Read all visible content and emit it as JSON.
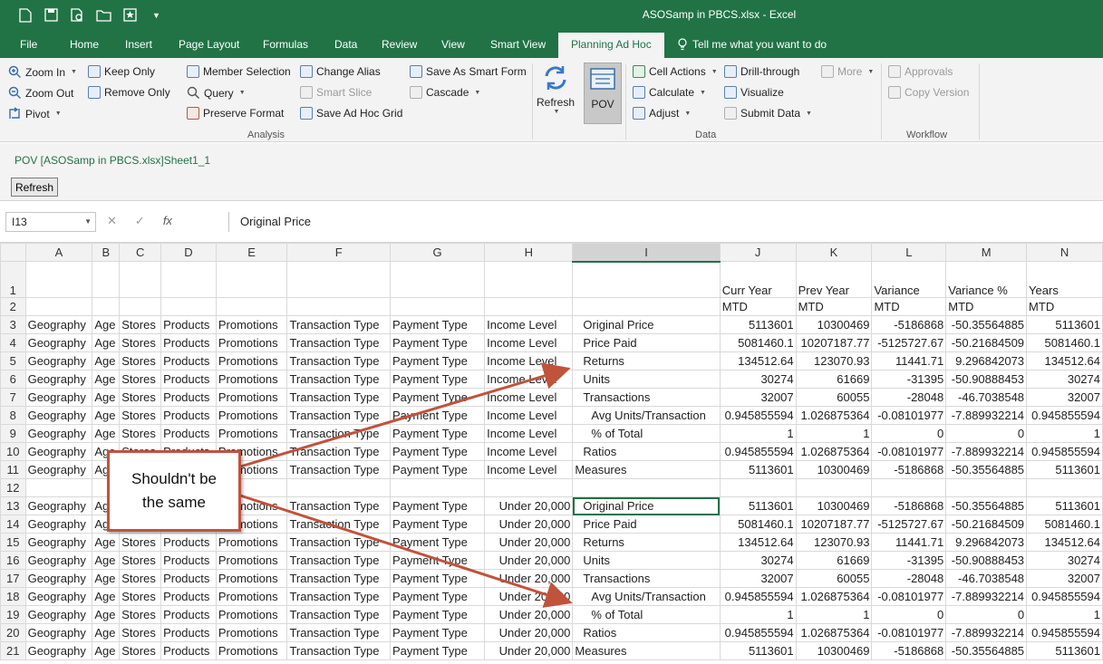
{
  "window": {
    "title": "ASOSamp in PBCS.xlsx  -  Excel"
  },
  "qat_icons": [
    "new-file-icon",
    "save-icon",
    "print-preview-icon",
    "open-folder-icon",
    "smart-view-icon",
    "qat-customize-icon"
  ],
  "tabs": [
    "File",
    "Home",
    "Insert",
    "Page Layout",
    "Formulas",
    "Data",
    "Review",
    "View",
    "Smart View",
    "Planning Ad Hoc"
  ],
  "active_tab": "Planning Ad Hoc",
  "tell_me": "Tell me what you want to do",
  "ribbon": {
    "analysis": {
      "label": "Analysis",
      "zoom_in": "Zoom In",
      "zoom_out": "Zoom Out",
      "pivot": "Pivot",
      "keep_only": "Keep Only",
      "remove_only": "Remove Only",
      "member_selection": "Member Selection",
      "query": "Query",
      "preserve_format": "Preserve Format",
      "change_alias": "Change Alias",
      "smart_slice": "Smart Slice",
      "save_ad_hoc_grid": "Save Ad Hoc Grid",
      "save_as_smart_form": "Save As Smart Form",
      "cascade": "Cascade"
    },
    "refresh": "Refresh",
    "pov": "POV",
    "data": {
      "label": "Data",
      "cell_actions": "Cell Actions",
      "calculate": "Calculate",
      "adjust": "Adjust",
      "drill_through": "Drill-through",
      "visualize": "Visualize",
      "submit_data": "Submit Data",
      "more": "More"
    },
    "workflow": {
      "label": "Workflow",
      "approvals": "Approvals",
      "copy_version": "Copy Version"
    }
  },
  "pov_panel": {
    "title": "POV [ASOSamp in PBCS.xlsx]Sheet1_1",
    "refresh": "Refresh"
  },
  "formula_bar": {
    "name_box": "I13",
    "cancel": "✕",
    "enter": "✓",
    "fx": "fx",
    "formula": "Original Price"
  },
  "columns": [
    "A",
    "B",
    "C",
    "D",
    "E",
    "F",
    "G",
    "H",
    "I",
    "J",
    "K",
    "L",
    "M",
    "N"
  ],
  "selected_column": "I",
  "rows": [
    {
      "n": "1",
      "c": [
        "",
        "",
        "",
        "",
        "",
        "",
        "",
        "",
        "",
        "Curr Year",
        "Prev Year",
        "Variance",
        "Variance %",
        "Years"
      ]
    },
    {
      "n": "2",
      "c": [
        "",
        "",
        "",
        "",
        "",
        "",
        "",
        "",
        "",
        "MTD",
        "MTD",
        "MTD",
        "MTD",
        "MTD"
      ]
    },
    {
      "n": "3",
      "c": [
        "Geography",
        "Age",
        "Stores",
        "Products",
        "Promotions",
        "Transaction Type",
        "Payment Type",
        "Income Level",
        "Original Price",
        "5113601",
        "10300469",
        "-5186868",
        "-50.35564885",
        "5113601"
      ]
    },
    {
      "n": "4",
      "c": [
        "Geography",
        "Age",
        "Stores",
        "Products",
        "Promotions",
        "Transaction Type",
        "Payment Type",
        "Income Level",
        "Price Paid",
        "5081460.1",
        "10207187.77",
        "-5125727.67",
        "-50.21684509",
        "5081460.1"
      ]
    },
    {
      "n": "5",
      "c": [
        "Geography",
        "Age",
        "Stores",
        "Products",
        "Promotions",
        "Transaction Type",
        "Payment Type",
        "Income Level",
        "Returns",
        "134512.64",
        "123070.93",
        "11441.71",
        "9.296842073",
        "134512.64"
      ]
    },
    {
      "n": "6",
      "c": [
        "Geography",
        "Age",
        "Stores",
        "Products",
        "Promotions",
        "Transaction Type",
        "Payment Type",
        "Income Level",
        "Units",
        "30274",
        "61669",
        "-31395",
        "-50.90888453",
        "30274"
      ]
    },
    {
      "n": "7",
      "c": [
        "Geography",
        "Age",
        "Stores",
        "Products",
        "Promotions",
        "Transaction Type",
        "Payment Type",
        "Income Level",
        "Transactions",
        "32007",
        "60055",
        "-28048",
        "-46.7038548",
        "32007"
      ]
    },
    {
      "n": "8",
      "c": [
        "Geography",
        "Age",
        "Stores",
        "Products",
        "Promotions",
        "Transaction Type",
        "Payment Type",
        "Income Level",
        "Avg Units/Transaction",
        "0.945855594",
        "1.026875364",
        "-0.08101977",
        "-7.889932214",
        "0.945855594"
      ]
    },
    {
      "n": "9",
      "c": [
        "Geography",
        "Age",
        "Stores",
        "Products",
        "Promotions",
        "Transaction Type",
        "Payment Type",
        "Income Level",
        "% of Total",
        "1",
        "1",
        "0",
        "0",
        "1"
      ]
    },
    {
      "n": "10",
      "c": [
        "Geography",
        "Age",
        "Stores",
        "Products",
        "Promotions",
        "Transaction Type",
        "Payment Type",
        "Income Level",
        "Ratios",
        "0.945855594",
        "1.026875364",
        "-0.08101977",
        "-7.889932214",
        "0.945855594"
      ]
    },
    {
      "n": "11",
      "c": [
        "Geography",
        "Age",
        "Stores",
        "Products",
        "Promotions",
        "Transaction Type",
        "Payment Type",
        "Income Level",
        "Measures",
        "5113601",
        "10300469",
        "-5186868",
        "-50.35564885",
        "5113601"
      ]
    },
    {
      "n": "12",
      "c": [
        "",
        "",
        "",
        "",
        "",
        "",
        "",
        "",
        "",
        "",
        "",
        "",
        "",
        ""
      ]
    },
    {
      "n": "13",
      "c": [
        "Geography",
        "Age",
        "Stores",
        "Products",
        "Promotions",
        "Transaction Type",
        "Payment Type",
        "Under 20,000",
        "Original Price",
        "5113601",
        "10300469",
        "-5186868",
        "-50.35564885",
        "5113601"
      ]
    },
    {
      "n": "14",
      "c": [
        "Geography",
        "Age",
        "Stores",
        "Products",
        "Promotions",
        "Transaction Type",
        "Payment Type",
        "Under 20,000",
        "Price Paid",
        "5081460.1",
        "10207187.77",
        "-5125727.67",
        "-50.21684509",
        "5081460.1"
      ]
    },
    {
      "n": "15",
      "c": [
        "Geography",
        "Age",
        "Stores",
        "Products",
        "Promotions",
        "Transaction Type",
        "Payment Type",
        "Under 20,000",
        "Returns",
        "134512.64",
        "123070.93",
        "11441.71",
        "9.296842073",
        "134512.64"
      ]
    },
    {
      "n": "16",
      "c": [
        "Geography",
        "Age",
        "Stores",
        "Products",
        "Promotions",
        "Transaction Type",
        "Payment Type",
        "Under 20,000",
        "Units",
        "30274",
        "61669",
        "-31395",
        "-50.90888453",
        "30274"
      ]
    },
    {
      "n": "17",
      "c": [
        "Geography",
        "Age",
        "Stores",
        "Products",
        "Promotions",
        "Transaction Type",
        "Payment Type",
        "Under 20,000",
        "Transactions",
        "32007",
        "60055",
        "-28048",
        "-46.7038548",
        "32007"
      ]
    },
    {
      "n": "18",
      "c": [
        "Geography",
        "Age",
        "Stores",
        "Products",
        "Promotions",
        "Transaction Type",
        "Payment Type",
        "Under 20,000",
        "Avg Units/Transaction",
        "0.945855594",
        "1.026875364",
        "-0.08101977",
        "-7.889932214",
        "0.945855594"
      ]
    },
    {
      "n": "19",
      "c": [
        "Geography",
        "Age",
        "Stores",
        "Products",
        "Promotions",
        "Transaction Type",
        "Payment Type",
        "Under 20,000",
        "% of Total",
        "1",
        "1",
        "0",
        "0",
        "1"
      ]
    },
    {
      "n": "20",
      "c": [
        "Geography",
        "Age",
        "Stores",
        "Products",
        "Promotions",
        "Transaction Type",
        "Payment Type",
        "Under 20,000",
        "Ratios",
        "0.945855594",
        "1.026875364",
        "-0.08101977",
        "-7.889932214",
        "0.945855594"
      ]
    },
    {
      "n": "21",
      "c": [
        "Geography",
        "Age",
        "Stores",
        "Products",
        "Promotions",
        "Transaction Type",
        "Payment Type",
        "Under 20,000",
        "Measures",
        "5113601",
        "10300469",
        "-5186868",
        "-50.35564885",
        "5113601"
      ]
    }
  ],
  "selected_cell": "I13",
  "callout": {
    "text": "Shouldn't be the same",
    "border_color": "#c0533c"
  },
  "colors": {
    "excel_green": "#217346",
    "arrow": "#c0533c"
  }
}
